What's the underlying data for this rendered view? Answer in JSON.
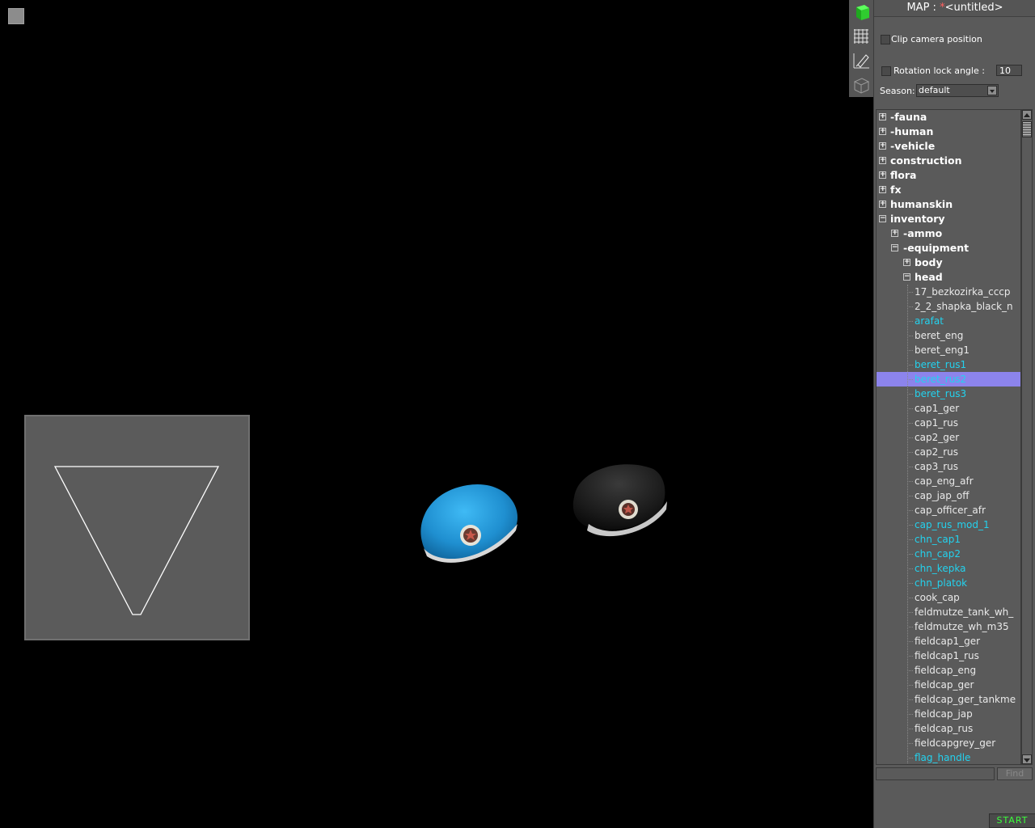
{
  "panel": {
    "title_prefix": "MAP :",
    "title_star": "*",
    "title_name": "<untitled>",
    "clip_camera_label": "Clip camera position",
    "rotation_lock_label": "Rotation lock angle :",
    "rotation_lock_value": "10",
    "season_label": "Season:",
    "season_value": "default",
    "find_label": "Find",
    "start_label": "START"
  },
  "toolbar": {
    "icons": [
      "green-cube-icon",
      "grid-icon",
      "ruler-pencil-icon",
      "wireframe-cube-icon"
    ]
  },
  "tree": [
    {
      "label": "-fauna",
      "level": 0,
      "expander": "+",
      "style": "folder"
    },
    {
      "label": "-human",
      "level": 0,
      "expander": "+",
      "style": "folder"
    },
    {
      "label": "-vehicle",
      "level": 0,
      "expander": "+",
      "style": "folder"
    },
    {
      "label": "construction",
      "level": 0,
      "expander": "+",
      "style": "folder"
    },
    {
      "label": "flora",
      "level": 0,
      "expander": "+",
      "style": "folder"
    },
    {
      "label": "fx",
      "level": 0,
      "expander": "+",
      "style": "folder"
    },
    {
      "label": "humanskin",
      "level": 0,
      "expander": "+",
      "style": "folder"
    },
    {
      "label": "inventory",
      "level": 0,
      "expander": "-",
      "style": "folder"
    },
    {
      "label": "-ammo",
      "level": 1,
      "expander": "+",
      "style": "folder"
    },
    {
      "label": "-equipment",
      "level": 1,
      "expander": "-",
      "style": "folder"
    },
    {
      "label": "body",
      "level": 2,
      "expander": "+",
      "style": "folder"
    },
    {
      "label": "head",
      "level": 2,
      "expander": "-",
      "style": "folder"
    },
    {
      "label": "17_bezkozirka_cccp",
      "level": 3,
      "style": "white"
    },
    {
      "label": "2_2_shapka_black_n",
      "level": 3,
      "style": "white"
    },
    {
      "label": "arafat",
      "level": 3,
      "style": "cyan"
    },
    {
      "label": "beret_eng",
      "level": 3,
      "style": "white"
    },
    {
      "label": "beret_eng1",
      "level": 3,
      "style": "white"
    },
    {
      "label": "beret_rus1",
      "level": 3,
      "style": "cyan"
    },
    {
      "label": "beret_rus2",
      "level": 3,
      "style": "cyan",
      "selected": true
    },
    {
      "label": "beret_rus3",
      "level": 3,
      "style": "cyan"
    },
    {
      "label": "cap1_ger",
      "level": 3,
      "style": "white"
    },
    {
      "label": "cap1_rus",
      "level": 3,
      "style": "white"
    },
    {
      "label": "cap2_ger",
      "level": 3,
      "style": "white"
    },
    {
      "label": "cap2_rus",
      "level": 3,
      "style": "white"
    },
    {
      "label": "cap3_rus",
      "level": 3,
      "style": "white"
    },
    {
      "label": "cap_eng_afr",
      "level": 3,
      "style": "white"
    },
    {
      "label": "cap_jap_off",
      "level": 3,
      "style": "white"
    },
    {
      "label": "cap_officer_afr",
      "level": 3,
      "style": "white"
    },
    {
      "label": "cap_rus_mod_1",
      "level": 3,
      "style": "cyan"
    },
    {
      "label": "chn_cap1",
      "level": 3,
      "style": "cyan"
    },
    {
      "label": "chn_cap2",
      "level": 3,
      "style": "cyan"
    },
    {
      "label": "chn_kepka",
      "level": 3,
      "style": "cyan"
    },
    {
      "label": "chn_platok",
      "level": 3,
      "style": "cyan"
    },
    {
      "label": "cook_cap",
      "level": 3,
      "style": "white"
    },
    {
      "label": "feldmutze_tank_wh_",
      "level": 3,
      "style": "white"
    },
    {
      "label": "feldmutze_wh_m35",
      "level": 3,
      "style": "white"
    },
    {
      "label": "fieldcap1_ger",
      "level": 3,
      "style": "white"
    },
    {
      "label": "fieldcap1_rus",
      "level": 3,
      "style": "white"
    },
    {
      "label": "fieldcap_eng",
      "level": 3,
      "style": "white"
    },
    {
      "label": "fieldcap_ger",
      "level": 3,
      "style": "white"
    },
    {
      "label": "fieldcap_ger_tankme",
      "level": 3,
      "style": "white"
    },
    {
      "label": "fieldcap_jap",
      "level": 3,
      "style": "white"
    },
    {
      "label": "fieldcap_rus",
      "level": 3,
      "style": "white"
    },
    {
      "label": "fieldcapgrey_ger",
      "level": 3,
      "style": "white"
    },
    {
      "label": "flag_handle",
      "level": 3,
      "style": "cyan"
    }
  ],
  "colors": {
    "cyan_item": "#23d2ee",
    "selection": "#8c84ec",
    "start_text": "#3bff3b",
    "title_star": "#ff6060"
  }
}
